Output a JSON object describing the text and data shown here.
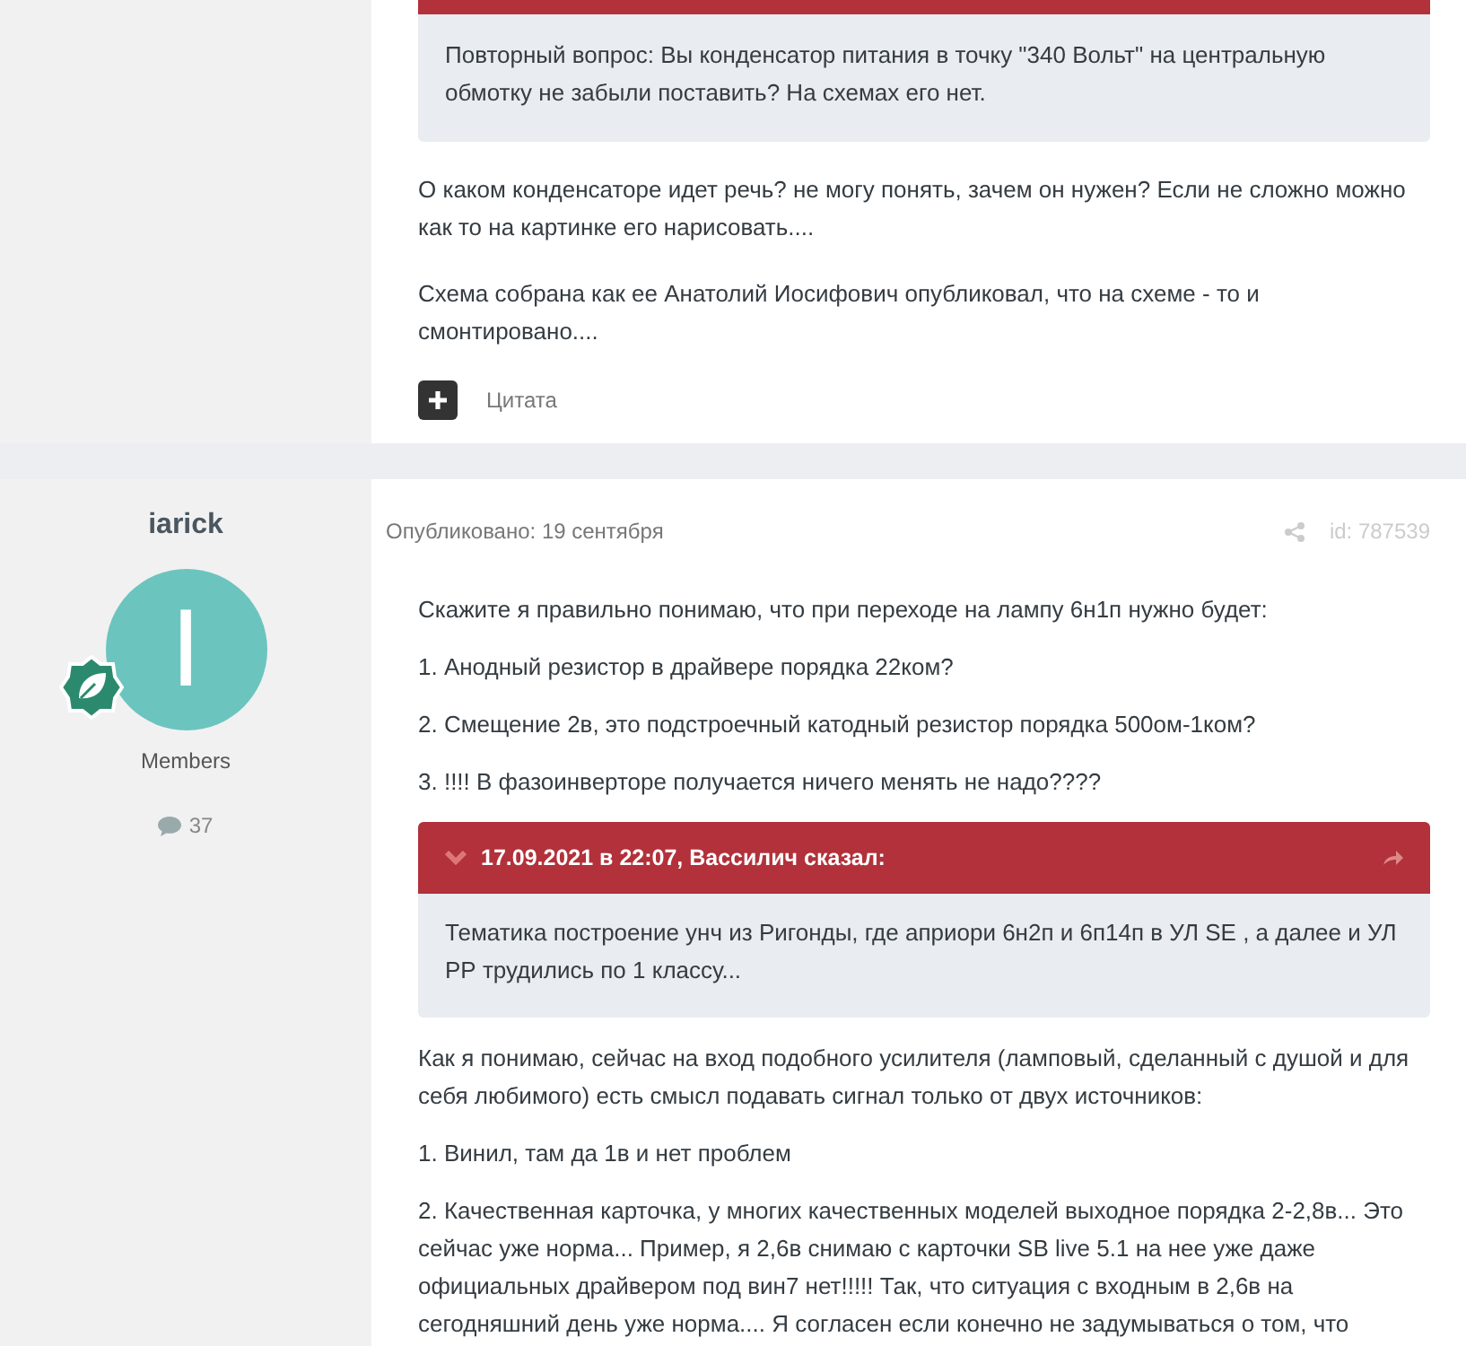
{
  "posts": [
    {
      "quote": {
        "text": "Повторный вопрос: Вы конденсатор питания в точку \"340 Вольт\" на  центральную обмотку не забыли поставить? На схемах его нет."
      },
      "paragraphs": [
        "О каком конденсаторе идет речь? не могу понять, зачем он нужен? Если не сложно можно как то на картинке его нарисовать....",
        "Схема собрана как ее Анатолий Иосифович опубликовал, что на схеме - то и смонтировано...."
      ],
      "quote_button": "Цитата"
    },
    {
      "author": {
        "name": "iarick",
        "avatar_letter": "I",
        "group": "Members",
        "posts_count": "37"
      },
      "posted": "Опубликовано: 19 сентября",
      "post_id": "id: 787539",
      "paragraphs_before": [
        "Скажите я правильно понимаю, что при переходе на лампу 6н1п нужно будет:",
        "1. Анодный резистор в драйвере порядка 22ком?",
        "2. Смещение 2в, это подстроечный катодный резистор порядка 500ом-1ком?",
        "3. !!!! В фазоинверторе получается ничего менять не надо????"
      ],
      "quote": {
        "header": "17.09.2021 в 22:07, Вассилич сказал:",
        "text": "Тематика построение унч из Ригонды, где априори 6н2п и 6п14п в УЛ SE , а далее и УЛ РР трудились по 1 классу..."
      },
      "paragraphs_after": [
        "Как я понимаю, сейчас на вход подобного усилителя (ламповый, сделанный с душой и для себя любимого) есть смысл подавать сигнал только от двух источников:",
        "1. Винил, там да 1в и нет проблем",
        "2. Качественная карточка, у многих качественных моделей выходное порядка 2-2,8в... Это сейчас уже норма... Пример, я 2,6в снимаю с карточки SB live 5.1 на нее уже даже официальных драйвером под вин7 нет!!!!! Так, что ситуация с входным в 2,6в на сегодняшний день уже норма.... Я согласен если конечно не задумываться о том, что"
      ]
    }
  ]
}
